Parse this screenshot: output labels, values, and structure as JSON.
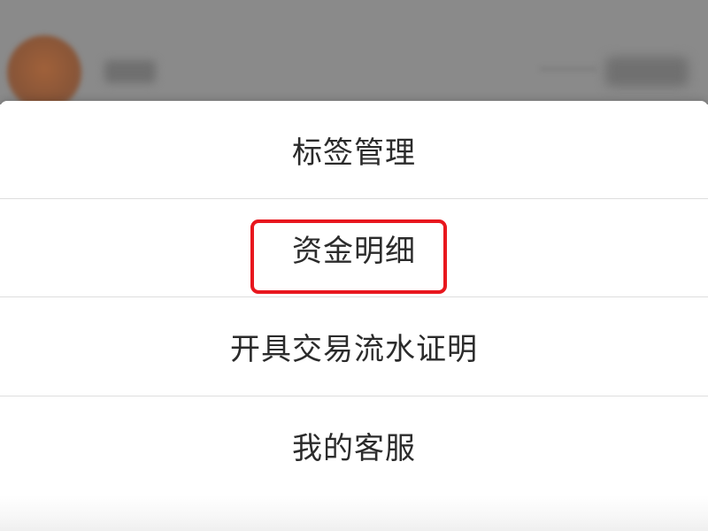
{
  "action_sheet": {
    "items": [
      {
        "label": "标签管理"
      },
      {
        "label": "资金明细",
        "highlighted": true
      },
      {
        "label": "开具交易流水证明"
      },
      {
        "label": "我的客服"
      }
    ],
    "highlight_color": "#e8171e"
  }
}
